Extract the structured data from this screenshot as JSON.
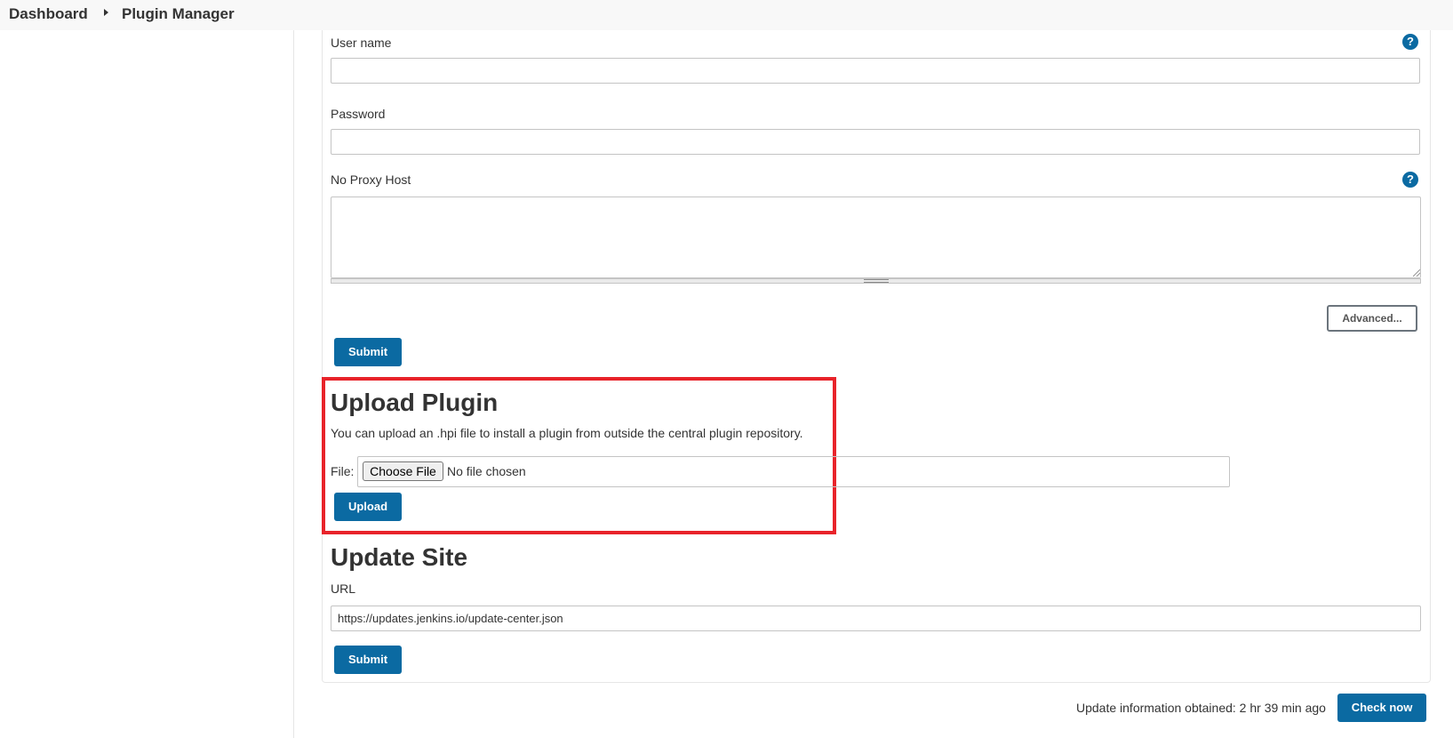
{
  "breadcrumb": {
    "items": [
      "Dashboard",
      "Plugin Manager"
    ]
  },
  "proxy": {
    "username_label": "User name",
    "password_label": "Password",
    "no_proxy_label": "No Proxy Host",
    "help_icon": "?",
    "advanced_label": "Advanced...",
    "submit_label": "Submit"
  },
  "upload": {
    "title": "Upload Plugin",
    "description": "You can upload an .hpi file to install a plugin from outside the central plugin repository.",
    "file_label": "File:",
    "choose_label": "Choose File",
    "no_file_text": "No file chosen",
    "upload_label": "Upload"
  },
  "update_site": {
    "title": "Update Site",
    "url_label": "URL",
    "url_value": "https://updates.jenkins.io/update-center.json",
    "submit_label": "Submit"
  },
  "footer": {
    "status_text": "Update information obtained: 2 hr 39 min ago",
    "check_now_label": "Check now"
  },
  "colors": {
    "primary": "#0b6aa2",
    "highlight": "#e8232a"
  }
}
